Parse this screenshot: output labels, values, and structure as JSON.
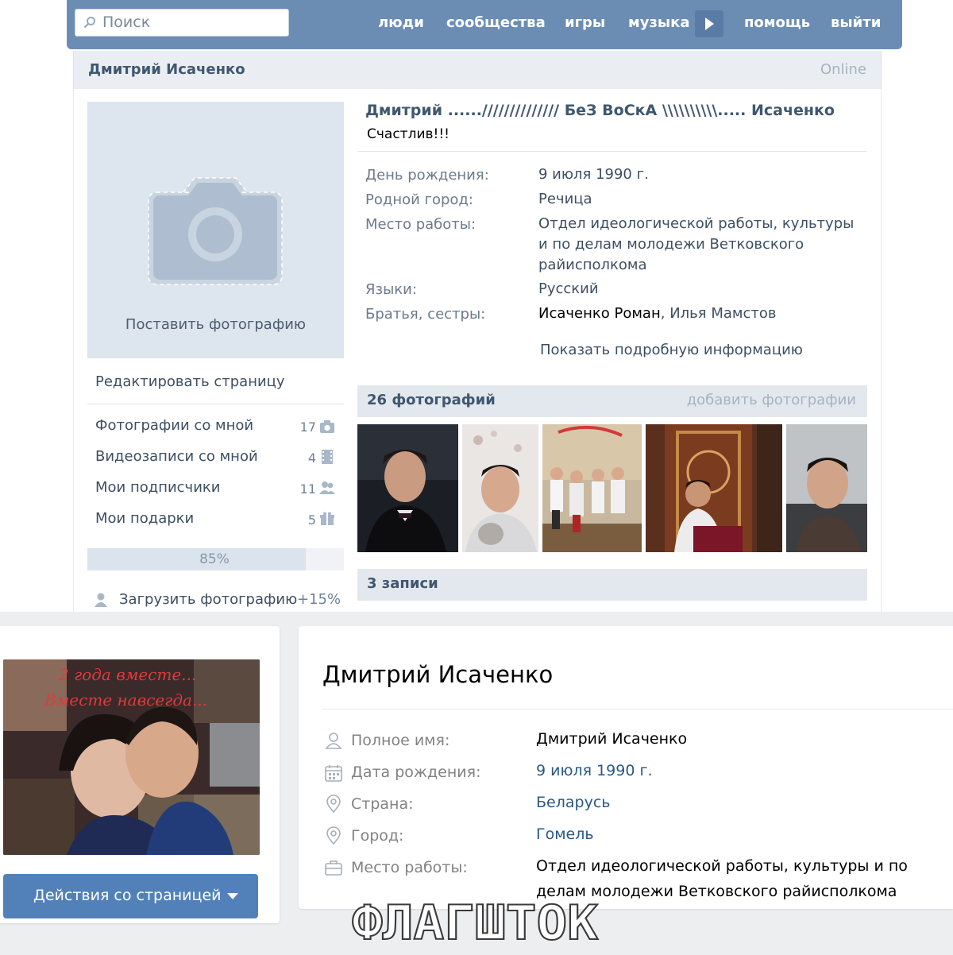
{
  "old_profile": {
    "search": {
      "placeholder": "Поиск"
    },
    "nav": [
      "люди",
      "сообщества",
      "игры",
      "музыка",
      "помощь",
      "выйти"
    ],
    "header": {
      "name": "Дмитрий Исаченко",
      "online": "Online"
    },
    "photo": {
      "set_photo": "Поставить фотографию"
    },
    "edit_page": "Редактировать страницу",
    "menu": [
      {
        "label": "Фотографии со мной",
        "count": "17",
        "icon": "camera-icon"
      },
      {
        "label": "Видеозаписи со мной",
        "count": "4",
        "icon": "film-icon"
      },
      {
        "label": "Мои подписчики",
        "count": "11",
        "icon": "users-icon"
      },
      {
        "label": "Мои подарки",
        "count": "5",
        "icon": "gift-icon"
      }
    ],
    "completion": {
      "text": "85%",
      "value": 0.85
    },
    "upload": {
      "label": "Загрузить фотографию",
      "bonus": "+15%"
    },
    "full_name": "Дмитрий ......////////////// БеЗ ВоСкА \\\\\\\\\\\\\\\\\\\\..... Исаченко",
    "status": "Счастлив!!!",
    "info": [
      {
        "label": "День рождения:",
        "value": "9 июля 1990 г."
      },
      {
        "label": "Родной город:",
        "value": "Речица"
      },
      {
        "label": "Место работы:",
        "value": "Отдел идеологической работы, культуры и по делам молодежи Ветковского райисполкома"
      },
      {
        "label": "Языки:",
        "value": "Русский"
      },
      {
        "label": "Братья, сестры:",
        "sibling1": "Исаченко Роман",
        "separator": ",",
        "sibling2": "Илья Мамстов"
      }
    ],
    "more_info": "Показать подробную информацию",
    "photos": {
      "title": "26 фотографий",
      "add": "добавить фотографии"
    },
    "posts": {
      "title": "3 записи"
    }
  },
  "new_profile": {
    "action_button": "Действия со страницей",
    "name": "Дмитрий Исаченко",
    "collage_caption": [
      "2 года вместе...",
      "Вместе навсегда..."
    ],
    "rows": [
      {
        "label": "Полное имя:",
        "value": "Дмитрий Исаченко",
        "icon": "person-icon"
      },
      {
        "label": "Дата рождения:",
        "value": "9 июля 1990 г.",
        "icon": "calendar-icon"
      },
      {
        "label": "Страна:",
        "value": "Беларусь",
        "icon": "location-icon"
      },
      {
        "label": "Город:",
        "value": "Гомель",
        "icon": "location-icon"
      },
      {
        "label": "Место работы:",
        "value": "Отдел идеологической работы, культуры и по делам молодежи Ветковского райисполкома",
        "icon": "briefcase-icon"
      }
    ]
  },
  "watermark": "ФЛАГШТОК",
  "colors": {
    "old_header": "#6b8db4",
    "new_button": "#5181b8",
    "link": "#2a5885"
  }
}
